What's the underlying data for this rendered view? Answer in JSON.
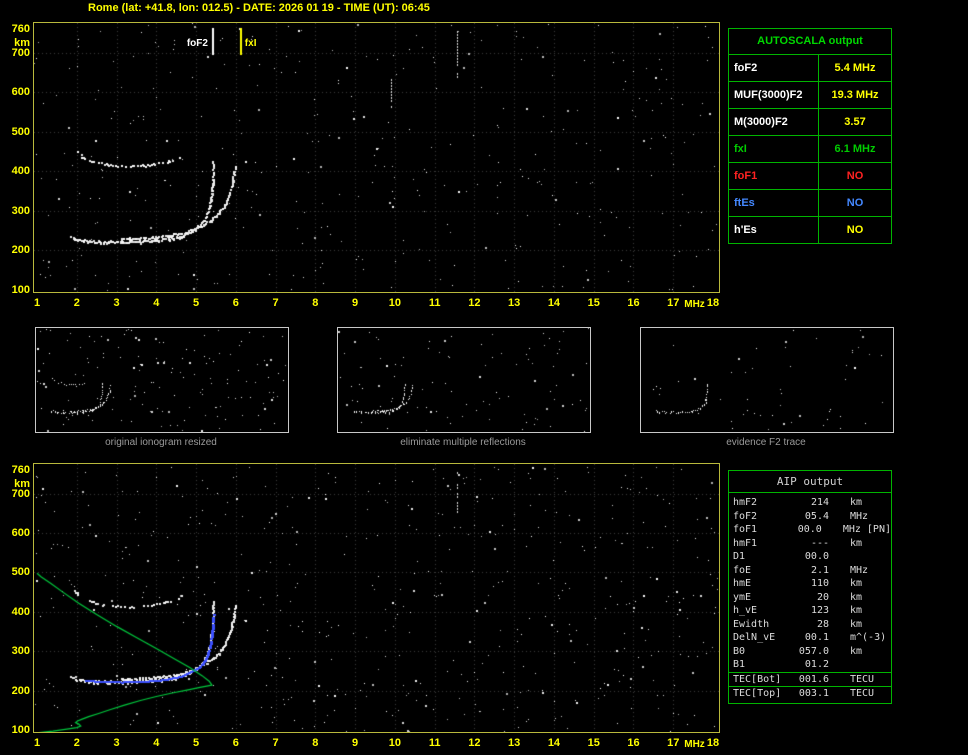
{
  "header": {
    "title": "Rome (lat: +41.8, lon: 012.5) - DATE: 2026 01 19 - TIME (UT): 06:45"
  },
  "colors": {
    "background": "#000000",
    "title": "#ffff00",
    "axis_label": "#ffff00",
    "plot_border": "#b9b93c",
    "grid": "#3a3a3a",
    "trace": "#ffffff",
    "table_border": "#00b400",
    "autoscala_header": "#00d800",
    "thumbnail_border": "#c8c8c8",
    "caption": "#9a9a9a",
    "profile_green": "#00c83c",
    "trace_blue": "#3c50ff",
    "marker_foF2": "#ffffff",
    "marker_fxI": "#ffff00"
  },
  "autoscala": {
    "header": "AUTOSCALA output",
    "rows": [
      {
        "label": "foF2",
        "value": "5.4 MHz",
        "label_color": "#ffffff",
        "value_color": "#ffff00"
      },
      {
        "label": "MUF(3000)F2",
        "value": "19.3 MHz",
        "label_color": "#ffffff",
        "value_color": "#ffff00"
      },
      {
        "label": "M(3000)F2",
        "value": "3.57",
        "label_color": "#ffffff",
        "value_color": "#ffff00"
      },
      {
        "label": "fxI",
        "value": "6.1 MHz",
        "label_color": "#00cc00",
        "value_color": "#00cc00"
      },
      {
        "label": "foF1",
        "value": "NO",
        "label_color": "#ff2222",
        "value_color": "#ff2222"
      },
      {
        "label": "ftEs",
        "value": "NO",
        "label_color": "#4488ff",
        "value_color": "#4488ff"
      },
      {
        "label": "h'Es",
        "value": "NO",
        "label_color": "#ffffff",
        "value_color": "#ffff00"
      }
    ]
  },
  "thumbnails": [
    {
      "caption": "original ionogram resized",
      "series": [
        "F2o",
        "F2x",
        "hop2"
      ],
      "noise": 150
    },
    {
      "caption": "eliminate multiple reflections",
      "series": [
        "F2o",
        "F2x"
      ],
      "noise": 100
    },
    {
      "caption": "evidence F2 trace",
      "series": [
        "F2o"
      ],
      "noise": 55
    }
  ],
  "aip": {
    "header": "AIP output",
    "rows": [
      {
        "label": "hmF2",
        "value": "214",
        "unit": "km"
      },
      {
        "label": "foF2",
        "value": "05.4",
        "unit": "MHz"
      },
      {
        "label": "foF1",
        "value": "00.0",
        "unit": "MHz [PN]"
      },
      {
        "label": "hmF1",
        "value": "---",
        "unit": "km"
      },
      {
        "label": "D1",
        "value": "00.0",
        "unit": ""
      },
      {
        "label": "foE",
        "value": "2.1",
        "unit": "MHz"
      },
      {
        "label": "hmE",
        "value": "110",
        "unit": "km"
      },
      {
        "label": "ymE",
        "value": "20",
        "unit": "km"
      },
      {
        "label": "h_vE",
        "value": "123",
        "unit": "km"
      },
      {
        "label": "Ewidth",
        "value": "28",
        "unit": "km"
      },
      {
        "label": "DelN_vE",
        "value": "00.1",
        "unit": "m^(-3)"
      },
      {
        "label": "B0",
        "value": "057.0",
        "unit": "km"
      },
      {
        "label": "B1",
        "value": "01.2",
        "unit": ""
      },
      {
        "label": "TEC[Bot]",
        "value": "001.6",
        "unit": "TECU",
        "sep_above": true
      },
      {
        "label": "TEC[Top]",
        "value": "003.1",
        "unit": "TECU",
        "sep_above": true
      }
    ]
  },
  "chart_data": [
    {
      "id": "top_ionogram",
      "type": "scatter",
      "title": "ionogram with autoscaled characteristics",
      "xlabel": "MHz",
      "ylabel": "km",
      "xlim": [
        1,
        18
      ],
      "ylim": [
        100,
        760
      ],
      "x_ticks": [
        1,
        2,
        3,
        4,
        5,
        6,
        7,
        8,
        9,
        10,
        11,
        12,
        13,
        14,
        15,
        16,
        17,
        18
      ],
      "y_ticks": [
        100,
        200,
        300,
        400,
        500,
        600,
        700,
        760
      ],
      "grid": true,
      "legend": "none",
      "markers": [
        {
          "label": "foF2",
          "freq": 5.4,
          "color": "#ffffff"
        },
        {
          "label": "fxI",
          "freq": 6.1,
          "color": "#ffff00"
        }
      ],
      "series": [
        {
          "key": "F2o",
          "name": "F2 layer ordinary trace",
          "points": [
            [
              1.85,
              236
            ],
            [
              1.95,
              230
            ],
            [
              2.1,
              227
            ],
            [
              2.35,
              225
            ],
            [
              2.6,
              224
            ],
            [
              2.9,
              223
            ],
            [
              3.2,
              223
            ],
            [
              3.5,
              224
            ],
            [
              3.8,
              226
            ],
            [
              4.1,
              228
            ],
            [
              4.35,
              232
            ],
            [
              4.6,
              238
            ],
            [
              4.8,
              246
            ],
            [
              4.95,
              255
            ],
            [
              5.1,
              266
            ],
            [
              5.2,
              280
            ],
            [
              5.28,
              297
            ],
            [
              5.34,
              318
            ],
            [
              5.38,
              344
            ],
            [
              5.41,
              375
            ],
            [
              5.42,
              405
            ],
            [
              5.43,
              430
            ]
          ]
        },
        {
          "key": "F2x",
          "name": "F2 layer extraordinary trace",
          "points": [
            [
              3.1,
              231
            ],
            [
              3.5,
              232
            ],
            [
              3.9,
              234
            ],
            [
              4.25,
              238
            ],
            [
              4.55,
              243
            ],
            [
              4.8,
              250
            ],
            [
              5.0,
              258
            ],
            [
              5.2,
              268
            ],
            [
              5.4,
              281
            ],
            [
              5.55,
              296
            ],
            [
              5.7,
              315
            ],
            [
              5.8,
              338
            ],
            [
              5.88,
              365
            ],
            [
              5.94,
              395
            ],
            [
              5.98,
              420
            ]
          ]
        },
        {
          "key": "hop2",
          "name": "second-hop multiple reflection",
          "sparse": true,
          "points": [
            [
              1.95,
              455
            ],
            [
              2.05,
              444
            ],
            [
              2.2,
              434
            ],
            [
              2.4,
              426
            ],
            [
              2.65,
              420
            ],
            [
              2.95,
              416
            ],
            [
              3.25,
              414
            ],
            [
              3.55,
              415
            ],
            [
              3.85,
              418
            ],
            [
              4.15,
              423
            ],
            [
              4.45,
              431
            ],
            [
              4.65,
              442
            ]
          ]
        }
      ],
      "streaks": [
        {
          "freq": 11.55,
          "km_from": 640,
          "km_to": 755
        },
        {
          "freq": 9.9,
          "km_from": 560,
          "km_to": 640
        }
      ],
      "noise_points": 380
    },
    {
      "id": "bottom_ionogram",
      "type": "scatter",
      "title": "ionogram with restored F2 trace and electron density profile",
      "xlabel": "MHz",
      "ylabel": "km",
      "xlim": [
        1,
        18
      ],
      "ylim": [
        100,
        760
      ],
      "x_ticks": [
        1,
        2,
        3,
        4,
        5,
        6,
        7,
        8,
        9,
        10,
        11,
        12,
        13,
        14,
        15,
        16,
        17,
        18
      ],
      "y_ticks": [
        100,
        200,
        300,
        400,
        500,
        600,
        700,
        760
      ],
      "grid": true,
      "series_ref": "top_ionogram",
      "overlays": [
        {
          "name": "restored F2 trace",
          "style": "dots",
          "color": "#3c50ff",
          "points": [
            [
              2.2,
              227
            ],
            [
              2.5,
              225
            ],
            [
              2.8,
              224
            ],
            [
              3.1,
              223
            ],
            [
              3.4,
              224
            ],
            [
              3.7,
              225
            ],
            [
              4.0,
              227
            ],
            [
              4.3,
              231
            ],
            [
              4.6,
              238
            ],
            [
              4.8,
              246
            ],
            [
              5.0,
              257
            ],
            [
              5.15,
              270
            ],
            [
              5.25,
              287
            ],
            [
              5.32,
              310
            ],
            [
              5.37,
              338
            ],
            [
              5.4,
              370
            ],
            [
              5.42,
              400
            ]
          ]
        },
        {
          "name": "electron density profile (plasma frequency vs height)",
          "style": "line",
          "color": "#00c83c",
          "points": [
            [
              1.0,
              93
            ],
            [
              1.4,
              97
            ],
            [
              1.75,
              102
            ],
            [
              2.0,
              106
            ],
            [
              2.1,
              110
            ],
            [
              2.05,
              115
            ],
            [
              1.97,
              119
            ],
            [
              2.02,
              123
            ],
            [
              2.12,
              127
            ],
            [
              2.3,
              134
            ],
            [
              2.55,
              142
            ],
            [
              2.85,
              152
            ],
            [
              3.2,
              163
            ],
            [
              3.6,
              175
            ],
            [
              4.0,
              185
            ],
            [
              4.4,
              194
            ],
            [
              4.8,
              202
            ],
            [
              5.1,
              208
            ],
            [
              5.3,
              212
            ],
            [
              5.4,
              214
            ],
            [
              5.33,
              224
            ],
            [
              5.15,
              238
            ],
            [
              4.85,
              258
            ],
            [
              4.45,
              281
            ],
            [
              4.0,
              307
            ],
            [
              3.5,
              335
            ],
            [
              3.0,
              363
            ],
            [
              2.5,
              393
            ],
            [
              2.05,
              422
            ],
            [
              1.65,
              450
            ],
            [
              1.35,
              472
            ],
            [
              1.1,
              489
            ],
            [
              1.0,
              498
            ]
          ]
        }
      ],
      "streaks": [
        {
          "freq": 11.55,
          "km_from": 650,
          "km_to": 755
        }
      ],
      "noise_points": 520
    }
  ]
}
